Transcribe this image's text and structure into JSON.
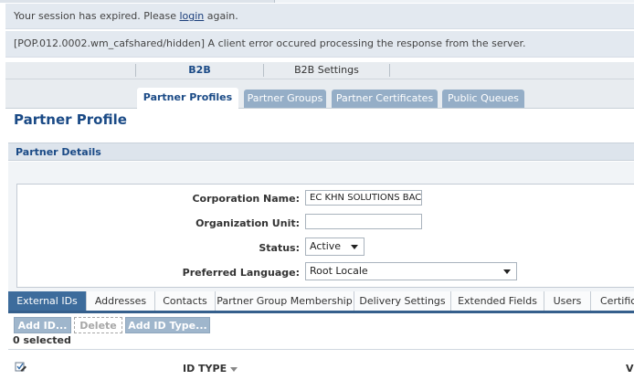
{
  "messages": {
    "session_prefix": "Your session has expired. Please ",
    "session_link": "login",
    "session_suffix": " again.",
    "error": "[POP.012.0002.wm_cafshared/hidden] A client error occured processing the response from the server."
  },
  "app_nav": {
    "items": [
      {
        "label": "B2B",
        "active": true
      },
      {
        "label": "B2B Settings",
        "active": false
      }
    ]
  },
  "page_tabs": [
    {
      "label": "Partner Profiles",
      "selected": true
    },
    {
      "label": "Partner Groups",
      "selected": false
    },
    {
      "label": "Partner Certificates",
      "selected": false
    },
    {
      "label": "Public Queues",
      "selected": false
    }
  ],
  "page_title": "Partner Profile",
  "panel_title": "Partner Details",
  "form": {
    "corporation_name_label": "Corporation Name:",
    "corporation_name_value": "EC  KHN SOLUTIONS BAC",
    "organization_unit_label": "Organization Unit:",
    "organization_unit_value": "",
    "status_label": "Status:",
    "status_value": "Active",
    "preferred_language_label": "Preferred Language:",
    "preferred_language_value": "Root Locale"
  },
  "sub_tabs": [
    {
      "label": "External IDs",
      "selected": true
    },
    {
      "label": "Addresses",
      "selected": false
    },
    {
      "label": "Contacts",
      "selected": false
    },
    {
      "label": "Partner Group Membership",
      "selected": false
    },
    {
      "label": "Delivery Settings",
      "selected": false
    },
    {
      "label": "Extended Fields",
      "selected": false
    },
    {
      "label": "Users",
      "selected": false
    },
    {
      "label": "Certific",
      "selected": false
    }
  ],
  "toolbar": {
    "add_id_label": "Add ID...",
    "delete_label": "Delete",
    "add_id_type_label": "Add ID Type..."
  },
  "selection_count": "0 selected",
  "grid": {
    "id_type_header": "ID TYPE",
    "trailing_header": "V"
  },
  "icons": {
    "select_all": "edit-checkbox-icon",
    "sort": "sort-down-icon",
    "dropdown": "chevron-down-icon"
  },
  "colors": {
    "title_blue": "#1a4a86",
    "tab_inactive": "#95aec7",
    "subtab_selected": "#3d6c9c",
    "button": "#9fb6cc"
  }
}
